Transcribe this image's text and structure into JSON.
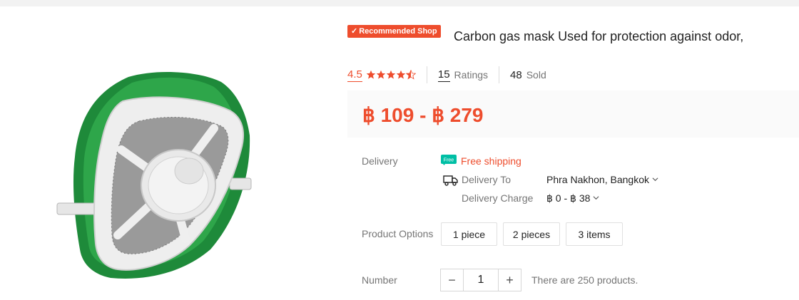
{
  "badge": {
    "check": "✓",
    "label": "Recommended Shop"
  },
  "title": "Carbon gas mask Used for protection against odor,",
  "rating": {
    "score": "4.5",
    "stars": 4.5,
    "ratings_count": "15",
    "ratings_label": "Ratings",
    "sold_count": "48",
    "sold_label": "Sold"
  },
  "price": "฿ 109 - ฿ 279",
  "delivery": {
    "label": "Delivery",
    "free_shipping": "Free shipping",
    "free_icon_text": "Free",
    "to_label": "Delivery To",
    "to_value": "Phra Nakhon, Bangkok",
    "charge_label": "Delivery Charge",
    "charge_value": "฿ 0 - ฿ 38"
  },
  "options": {
    "label": "Product Options",
    "items": [
      "1 piece",
      "2 pieces",
      "3 items"
    ]
  },
  "number": {
    "label": "Number",
    "minus": "−",
    "quantity": "1",
    "plus": "+",
    "stock_text": "There are 250 products."
  },
  "colors": {
    "accent": "#ee4d2d",
    "price_bg": "#fafafa",
    "free_green": "#00bfa5"
  }
}
